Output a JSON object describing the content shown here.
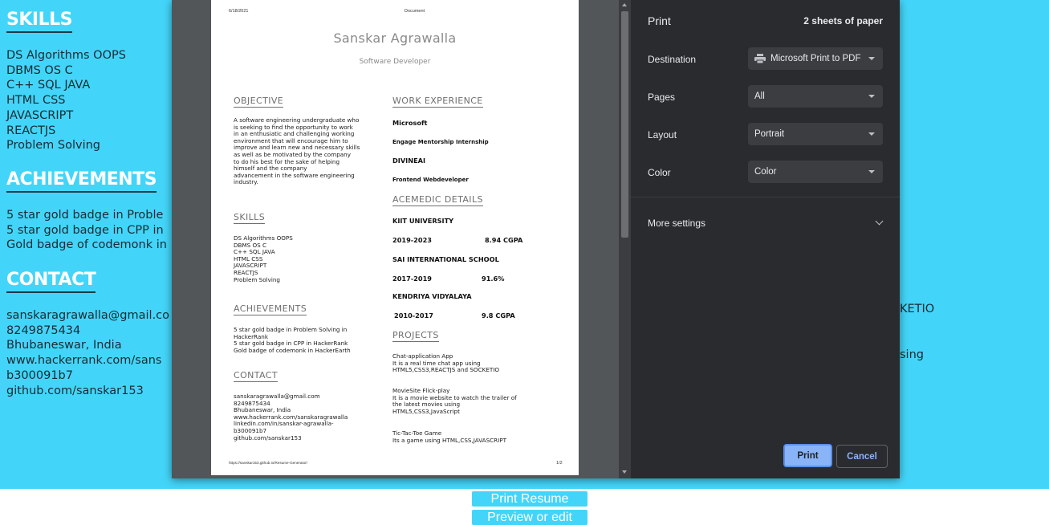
{
  "background_page": {
    "skills_heading": "SKILLS",
    "skills": [
      "DS Algorithms OOPS",
      "DBMS OS C",
      "C++ SQL JAVA",
      "HTML CSS",
      "JAVASCRIPT",
      "REACTJS",
      "Problem Solving"
    ],
    "achievements_heading": "ACHIEVEMENTS",
    "achievements": [
      "5 star gold badge in Proble",
      "5 star gold badge in CPP in",
      "Gold badge of codemonk in"
    ],
    "contact_heading": "CONTACT",
    "contact": [
      "sanskaragrawalla@gmail.co",
      "8249875434",
      "Bhubaneswar, India",
      "www.hackerrank.com/sans",
      "b300091b7",
      "github.com/sanskar153"
    ],
    "side_text_1": "KETIO",
    "side_text_2": "sing"
  },
  "sheet": {
    "header_date": "6/18/2021",
    "header_title": "Document",
    "name": "Sanskar Agrawalla",
    "role": "Software Developer",
    "objective_title": "OBJECTIVE",
    "objective_lines": [
      "A software engineering undergraduate who",
      "is seeking to find the opportunity to work",
      "in an enthusiatic and challenging working",
      "environment that will encourage him to",
      "improve and learn new and necessary skills",
      "as well as be motivated by the company",
      "to do his best for the sake of helping",
      "himself and the company",
      "advancement in the software engineering",
      "industry."
    ],
    "skills_title": "SKILLS",
    "skills": [
      "DS Algorithms OOPS",
      "DBMS OS C",
      "C++ SQL JAVA",
      "HTML CSS",
      "JAVASCRIPT",
      "REACTJS",
      "Problem Solving"
    ],
    "achievements_title": "ACHIEVEMENTS",
    "achievements": [
      "5 star gold badge in Problem Solving in",
      "HackerRank",
      "5 star gold badge in CPP in HackerRank",
      "Gold badge of codemonk in HackerEarth"
    ],
    "contact_title": "CONTACT",
    "contact": [
      "sanskaragrawalla@gmail.com",
      "8249875434",
      "Bhubaneswar, India",
      "www.hackerrank.com/sanskaragrawalla",
      "linkedin.com/in/sanskar-agrawalla-",
      "b300091b7",
      "github.com/sanskar153"
    ],
    "work_title": "WORK EXPERIENCE",
    "work_company_1": "Microsoft",
    "work_role_1": "Engage Mentorship Internship",
    "work_company_2": "DIVINEAI",
    "work_role_2": "Frontend Webdeveloper",
    "edu_title": "ACEMEDIC DETAILS",
    "edu_school_1": "KIIT UNIVERSITY",
    "edu_years_1": "2019-2023",
    "edu_score_1": "8.94 CGPA",
    "edu_school_2": "SAI INTERNATIONAL SCHOOL",
    "edu_years_2": "2017-2019",
    "edu_score_2": "91.6%",
    "edu_school_3": "KENDRIYA VIDYALAYA",
    "edu_years_3": "2010-2017",
    "edu_score_3": "9.8 CGPA",
    "projects_title": "PROJECTS",
    "project_1": [
      "Chat-application App",
      "It is a real time chat app using",
      "HTML5,CSS3,REACTJS and SOCKETIO"
    ],
    "project_2": [
      "MovieSite Flick-play",
      "It is a movie website to watch the trailer of",
      "the latest movies using",
      "HTML5,CSS3,JavaScript"
    ],
    "project_3": [
      "Tic-Tac-Toe Game",
      "Its a game using HTML,CSS,JAVASCRIPT"
    ],
    "footer_url": "https://sanskar153.github.io/Resume-Generator/",
    "footer_page": "1/2"
  },
  "print_settings": {
    "title": "Print",
    "sheet_count": "2 sheets of paper",
    "destination_label": "Destination",
    "destination_value": "Microsoft Print to PDF",
    "pages_label": "Pages",
    "pages_value": "All",
    "layout_label": "Layout",
    "layout_value": "Portrait",
    "color_label": "Color",
    "color_value": "Color",
    "more_settings": "More settings",
    "print_button": "Print",
    "cancel_button": "Cancel"
  },
  "page_buttons": {
    "print_resume": "Print Resume",
    "preview_edit": "Preview or edit"
  },
  "colors": {
    "page_background": "#43d5f9",
    "dialog_background": "#2a2b2e",
    "preview_background": "#525659",
    "accent_blue": "#8ab4f8"
  }
}
